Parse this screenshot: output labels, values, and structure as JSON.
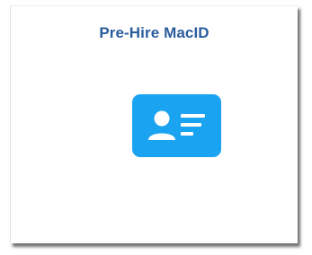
{
  "tile": {
    "title": "Pre-Hire MacID",
    "icon": "id-card-icon",
    "icon_color": "#1aa3f0",
    "title_color": "#2a5d9c"
  }
}
